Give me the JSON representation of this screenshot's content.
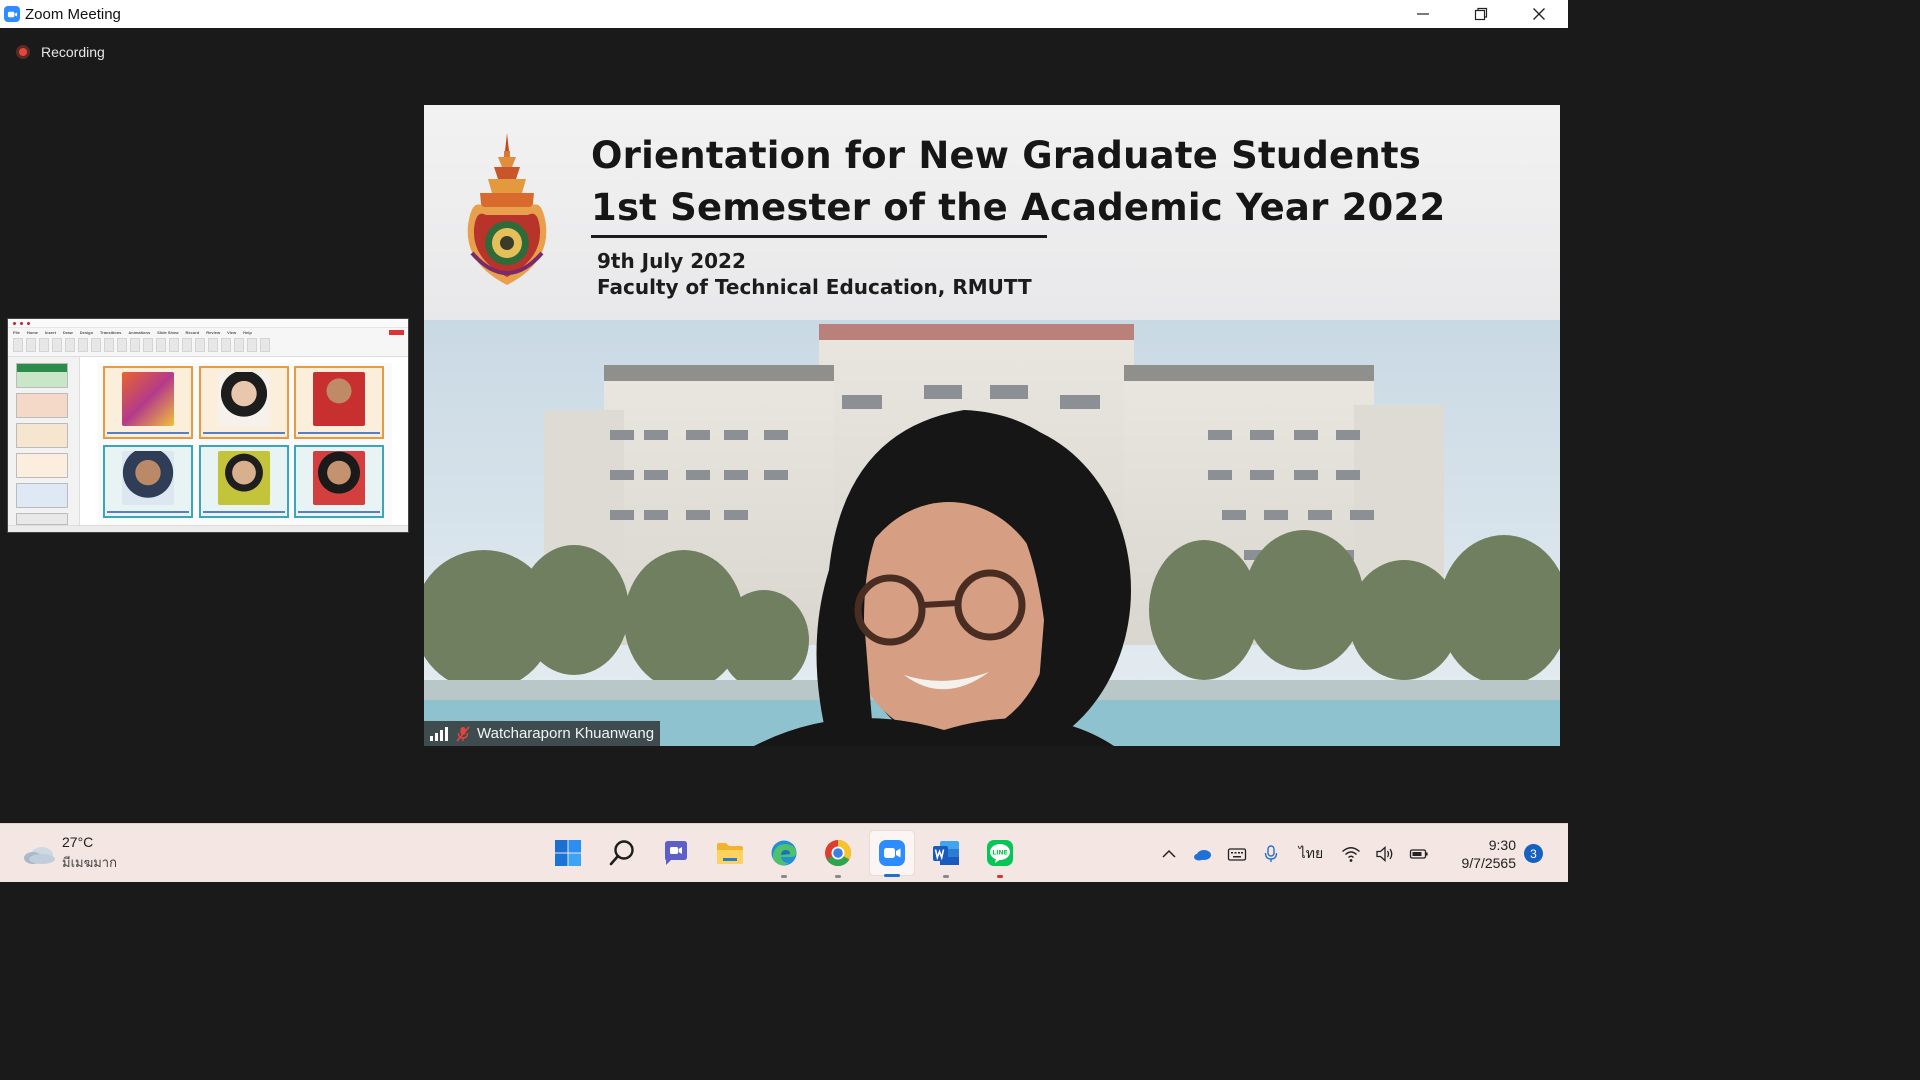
{
  "window": {
    "title": "Zoom Meeting",
    "minimize_icon": "minimize-icon",
    "restore_icon": "restore-icon",
    "close_icon": "close-icon"
  },
  "meeting": {
    "recording_label": "Recording",
    "recording_color": "#e5483b",
    "background": "#1a1a1a"
  },
  "active_speaker": {
    "participant_name": "Watcharaporn Khuanwang",
    "mic_status": "muted",
    "slide": {
      "title_line1": "Orientation for New Graduate Students",
      "title_line2": "1st Semester of the Academic Year 2022",
      "date": "9th July 2022",
      "faculty": "Faculty of Technical Education, RMUTT"
    }
  },
  "shared_screen_thumbnail": {
    "description_icon": "presentation-thumbnail",
    "card_count": 6
  },
  "taskbar": {
    "weather": {
      "temp": "27°C",
      "condition": "มีเมฆมาก",
      "icon": "cloud-icon"
    },
    "apps": [
      {
        "name": "start",
        "icon": "windows-icon"
      },
      {
        "name": "search",
        "icon": "search-icon"
      },
      {
        "name": "chat",
        "icon": "teams-chat-icon"
      },
      {
        "name": "file-explorer",
        "icon": "folder-icon"
      },
      {
        "name": "edge",
        "icon": "edge-icon"
      },
      {
        "name": "chrome",
        "icon": "chrome-icon"
      },
      {
        "name": "zoom",
        "icon": "zoom-icon",
        "active": true
      },
      {
        "name": "word",
        "icon": "word-icon"
      },
      {
        "name": "line",
        "icon": "line-icon"
      }
    ],
    "tray": {
      "language": "ไทย",
      "time": "9:30",
      "date": "9/7/2565",
      "notification_count": "3"
    }
  }
}
